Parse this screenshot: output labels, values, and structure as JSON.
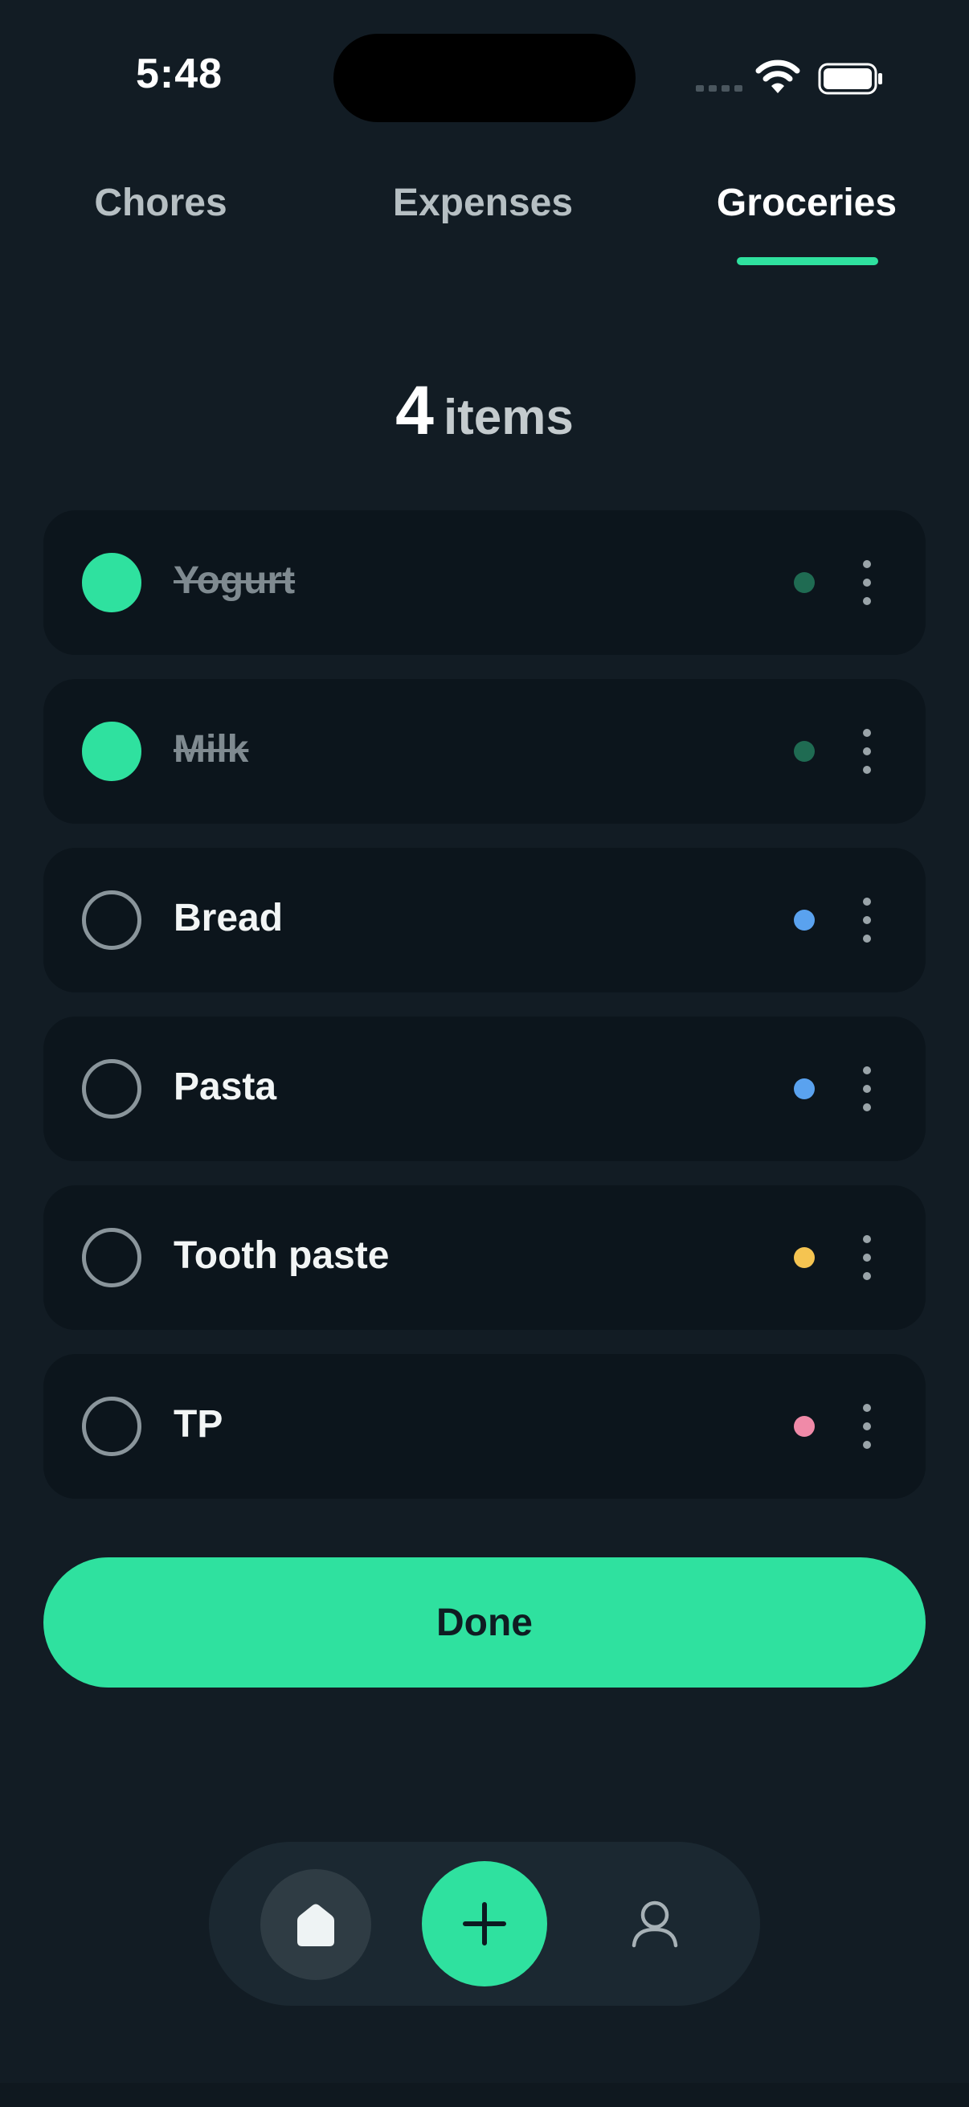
{
  "status_bar": {
    "time": "5:48"
  },
  "tabs": [
    {
      "label": "Chores",
      "active": false
    },
    {
      "label": "Expenses",
      "active": false
    },
    {
      "label": "Groceries",
      "active": true
    }
  ],
  "count": {
    "number": "4",
    "label": "items"
  },
  "items": [
    {
      "label": "Yogurt",
      "checked": true,
      "color": "#1f6b52"
    },
    {
      "label": "Milk",
      "checked": true,
      "color": "#1f6b52"
    },
    {
      "label": "Bread",
      "checked": false,
      "color": "#5aa2ef"
    },
    {
      "label": "Pasta",
      "checked": false,
      "color": "#5aa2ef"
    },
    {
      "label": "Tooth paste",
      "checked": false,
      "color": "#f5c451"
    },
    {
      "label": "TP",
      "checked": false,
      "color": "#f08aa8"
    }
  ],
  "done_button": {
    "label": "Done"
  },
  "colors": {
    "accent": "#2fe19f",
    "background": "#121c24",
    "card": "#0c151c"
  },
  "nav": {
    "icons": [
      "home-icon",
      "plus-icon",
      "user-icon"
    ]
  }
}
